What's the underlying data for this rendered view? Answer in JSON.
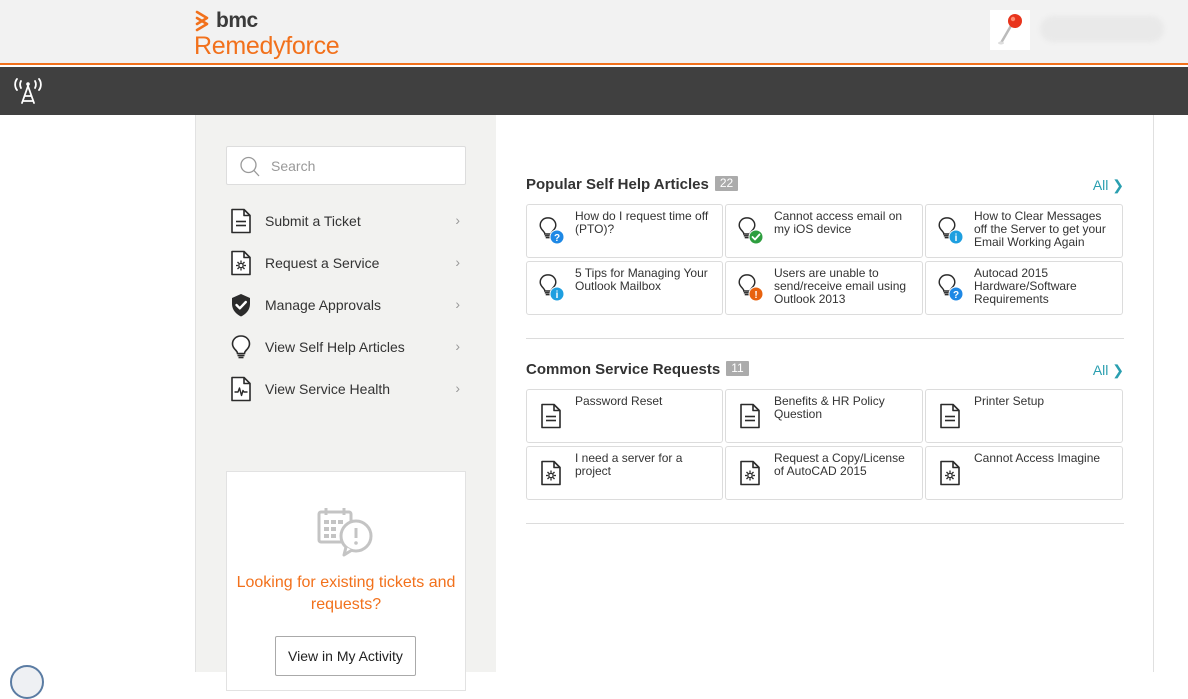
{
  "header": {
    "brand_small": "bmc",
    "brand_product": "Remedyforce",
    "user_avatar_icon": "pushpin-icon",
    "accent_color": "#f2711c"
  },
  "navbar": {
    "icon": "broadcast-tower-icon",
    "background": "#404040"
  },
  "sidebar": {
    "search_placeholder": "Search",
    "search_value": "",
    "items": [
      {
        "label": "Submit a Ticket",
        "icon": "document-icon",
        "chevron": "›"
      },
      {
        "label": "Request a Service",
        "icon": "service-document-icon",
        "chevron": "›"
      },
      {
        "label": "Manage Approvals",
        "icon": "shield-check-icon",
        "chevron": "›"
      },
      {
        "label": "View Self Help Articles",
        "icon": "lightbulb-icon",
        "chevron": "›"
      },
      {
        "label": "View Service Health",
        "icon": "health-document-icon",
        "chevron": "›"
      }
    ],
    "activity": {
      "icon": "calendar-alert-icon",
      "text": "Looking for existing tickets and requests?",
      "button_label": "View in My Activity"
    }
  },
  "main": {
    "articles": {
      "title": "Popular Self Help Articles",
      "count": "22",
      "all_label": "All ❯",
      "items": [
        {
          "text": "How do I request time off (PTO)?",
          "badge": "question",
          "badge_color": "#1e88e5"
        },
        {
          "text": "Cannot access email on my iOS device",
          "badge": "check",
          "badge_color": "#2e9e3f"
        },
        {
          "text": "How to Clear Messages off the Server to get your Email Working Again",
          "badge": "info",
          "badge_color": "#1e9fe0"
        },
        {
          "text": "5 Tips for Managing Your Outlook Mailbox",
          "badge": "info",
          "badge_color": "#1e9fe0"
        },
        {
          "text": "Users are unable to send/receive email using Outlook 2013",
          "badge": "warning",
          "badge_color": "#e8620e"
        },
        {
          "text": "Autocad 2015 Hardware/Software Requirements",
          "badge": "question",
          "badge_color": "#1e88e5"
        }
      ]
    },
    "requests": {
      "title": "Common Service Requests",
      "count": "11",
      "all_label": "All ❯",
      "items": [
        {
          "text": "Password Reset",
          "icon": "document-icon"
        },
        {
          "text": "Benefits & HR Policy Question",
          "icon": "document-icon"
        },
        {
          "text": "Printer Setup",
          "icon": "document-icon"
        },
        {
          "text": "I need a server for a project",
          "icon": "service-document-icon"
        },
        {
          "text": "Request a Copy/License of AutoCAD 2015",
          "icon": "service-document-icon"
        },
        {
          "text": "Cannot Access Imagine",
          "icon": "service-document-icon"
        }
      ]
    }
  }
}
